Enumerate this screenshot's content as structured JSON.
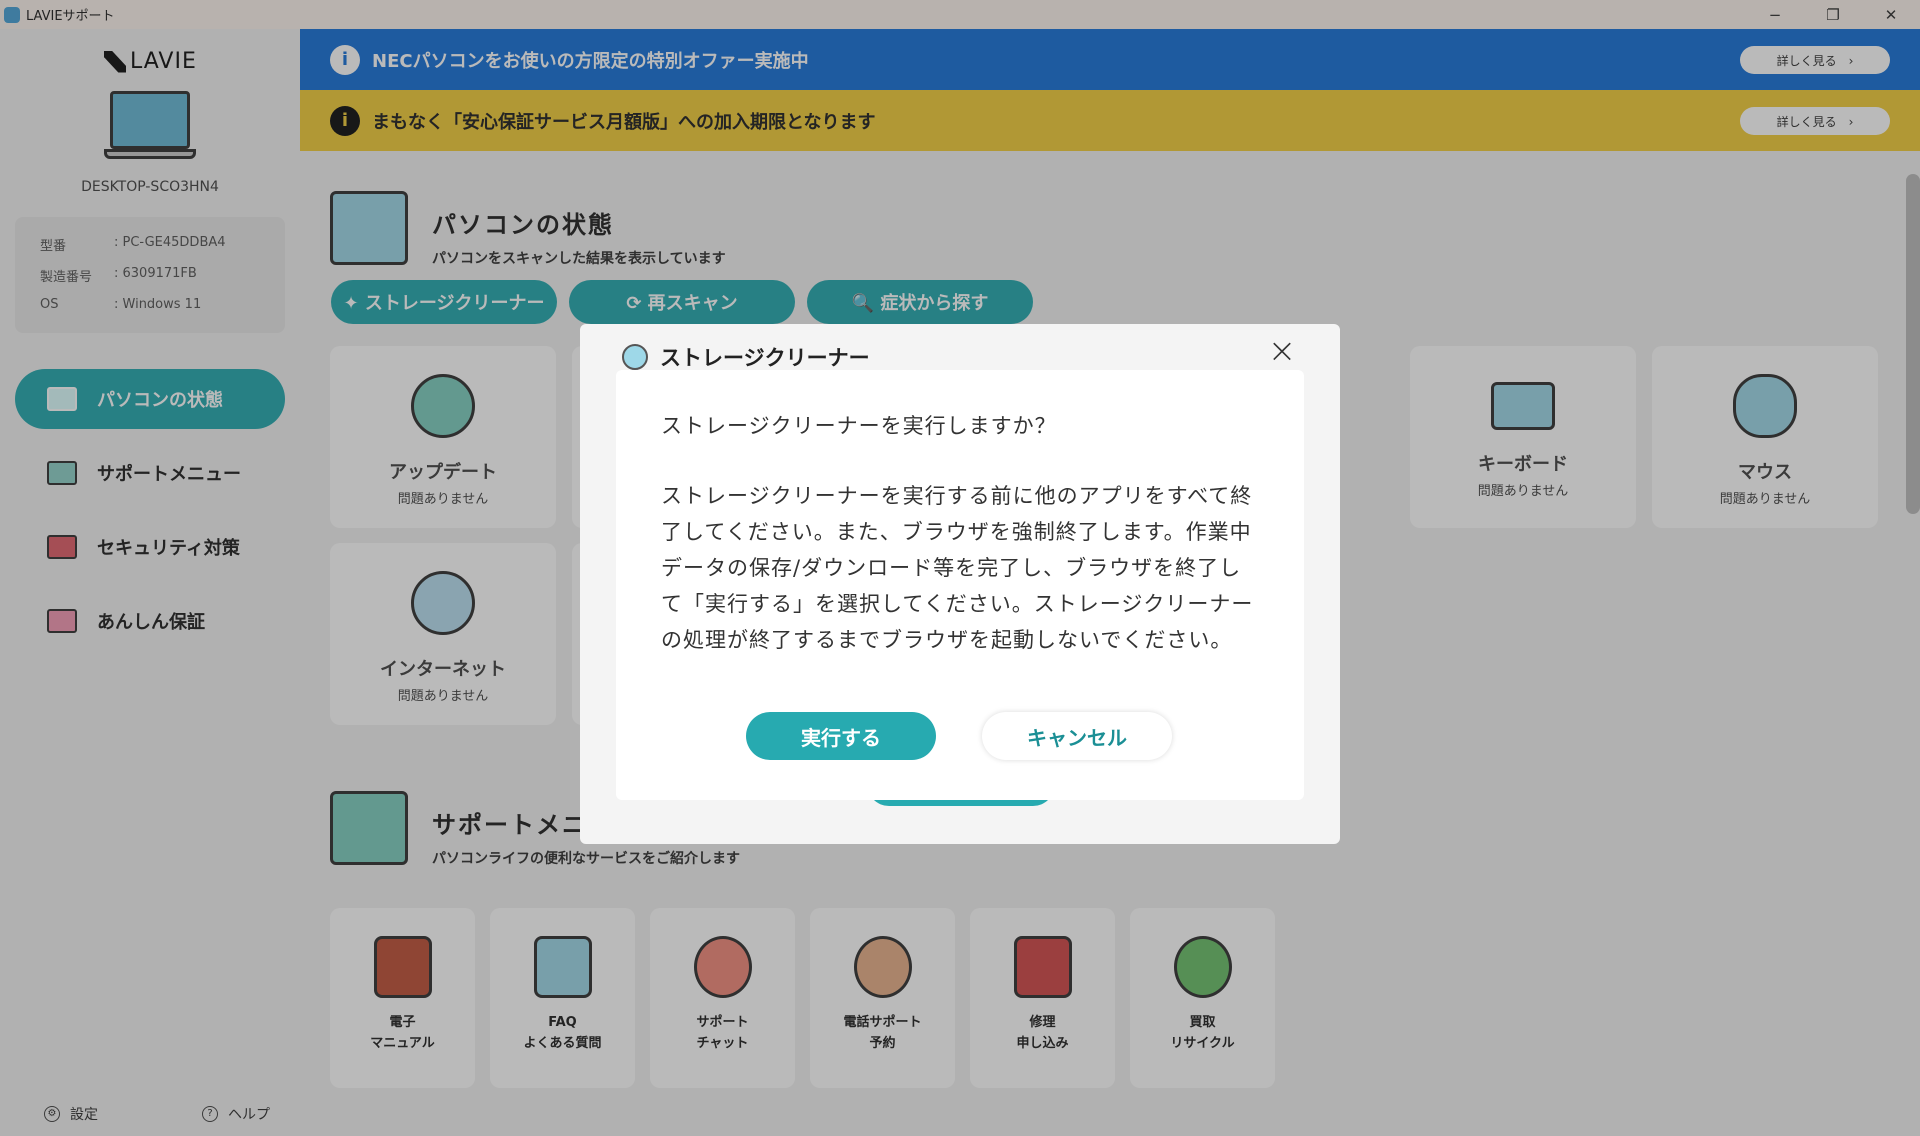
{
  "window": {
    "title": "LAVIEサポート",
    "minimize": "−",
    "restore": "❐",
    "close": "✕"
  },
  "sidebar": {
    "logo": "LAVIE",
    "hostname": "DESKTOP-SCO3HN4",
    "specs": [
      {
        "key": "型番",
        "value": ": PC-GE45DDBA4"
      },
      {
        "key": "製造番号",
        "value": ": 6309171FB"
      },
      {
        "key": "OS",
        "value": ": Windows 11"
      }
    ],
    "nav": [
      {
        "label": "パソコンの状態",
        "icon": "pc-status-icon",
        "active": true
      },
      {
        "label": "サポートメニュー",
        "icon": "support-menu-icon",
        "active": false
      },
      {
        "label": "セキュリティ対策",
        "icon": "security-icon",
        "active": false
      },
      {
        "label": "あんしん保証",
        "icon": "warranty-icon",
        "active": false
      }
    ],
    "footer": {
      "settings": "設定",
      "help": "ヘルプ"
    }
  },
  "banners": {
    "blue": {
      "text": "NECパソコンをお使いの方限定の特別オファー実施中",
      "button": "詳しく見る　›",
      "color": "#1a73d9"
    },
    "yellow": {
      "text": "まもなく「安心保証サービス月額版」への加入期限となります",
      "button": "詳しく見る　›",
      "color": "#f2cd3c"
    }
  },
  "status": {
    "title": "パソコンの状態",
    "subtitle": "パソコンをスキャンした結果を表示しています",
    "actions": [
      "✦ ストレージクリーナー",
      "⟳  再スキャン",
      "🔍  症状から探す"
    ],
    "tiles": [
      {
        "name": "アップデート",
        "state": "問題ありません"
      },
      {
        "name": "インターネット",
        "state": "問題ありません"
      },
      {
        "name": "キーボード",
        "state": "問題ありません"
      },
      {
        "name": "マウス",
        "state": "問題ありません"
      }
    ]
  },
  "support": {
    "title": "サポートメニュー",
    "subtitle": "パソコンライフの便利なサービスをご紹介します",
    "items": [
      "電子\nマニュアル",
      "FAQ\nよくある質問",
      "サポート\nチャット",
      "電話サポート\n予約",
      "修理\n申し込み",
      "買取\nリサイクル"
    ]
  },
  "panel": {
    "title": "ストレージクリーナー",
    "close": "×"
  },
  "dialog": {
    "question": "ストレージクリーナーを実行しますか？",
    "message": "ストレージクリーナーを実行する前に他のアプリをすべて終了してください。また、ブラウザを強制終了します。作業中データの保存/ダウンロード等を完了し、ブラウザを終了して「実行する」を選択してください。ストレージクリーナーの処理が終了するまでブラウザを起動しないでください。",
    "ok": "実行する",
    "cancel": "キャンセル"
  },
  "accent": "#27aab0"
}
